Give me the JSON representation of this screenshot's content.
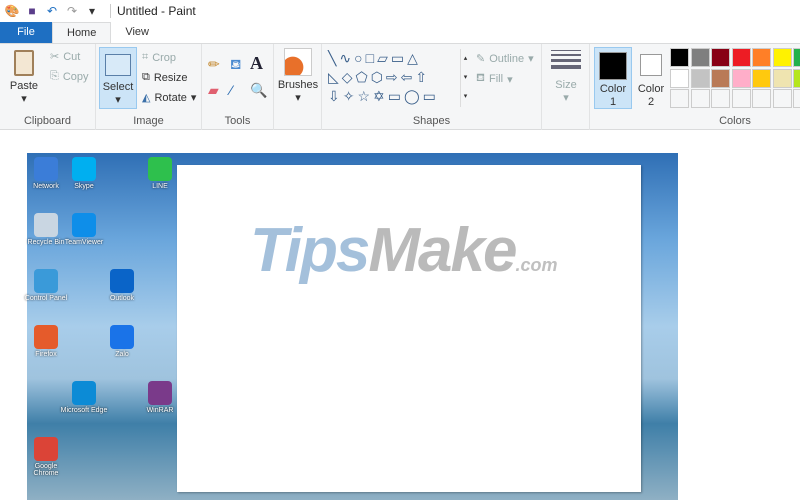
{
  "window": {
    "title": "Untitled - Paint"
  },
  "tabs": [
    {
      "label": "File"
    },
    {
      "label": "Home"
    },
    {
      "label": "View"
    }
  ],
  "clipboard": {
    "paste": "Paste",
    "cut": "Cut",
    "copy": "Copy",
    "label": "Clipboard"
  },
  "image": {
    "select": "Select",
    "crop": "Crop",
    "resize": "Resize",
    "rotate": "Rotate",
    "label": "Image"
  },
  "tools": {
    "label": "Tools"
  },
  "brushes": {
    "label": "Brushes"
  },
  "shapes": {
    "outline": "Outline",
    "fill": "Fill",
    "label": "Shapes"
  },
  "size": {
    "label": "Size"
  },
  "colors": {
    "color1": "Color",
    "color1_num": "1",
    "color2": "Color",
    "color2_num": "2",
    "label": "Colors",
    "color1_value": "#000000",
    "color2_value": "#ffffff",
    "palette": [
      "#000000",
      "#7f7f7f",
      "#880015",
      "#ed1c24",
      "#ff7f27",
      "#fff200",
      "#22b14c",
      "#ffffff",
      "#c3c3c3",
      "#b97a57",
      "#ffaec9",
      "#ffc90e",
      "#efe4b0",
      "#b5e61d"
    ]
  },
  "desktop_icons": [
    {
      "label": "Network",
      "color": "#3b7dd8"
    },
    {
      "label": "Skype",
      "color": "#00aff0"
    },
    {
      "label": "Recycle Bin",
      "color": "#c9d6e2"
    },
    {
      "label": "TeamViewer",
      "color": "#0e8ee9"
    },
    {
      "label": "Control Panel",
      "color": "#3a9ad9"
    },
    {
      "label": "Outlook",
      "color": "#0a64c8"
    },
    {
      "label": "Firefox",
      "color": "#e55b2b"
    },
    {
      "label": "Zalo",
      "color": "#1a73e8"
    },
    {
      "label": "Google Chrome",
      "color": "#db4437"
    },
    {
      "label": "Microsoft Edge",
      "color": "#0c8bd6"
    },
    {
      "label": "LINE",
      "color": "#2ec04d"
    },
    {
      "label": "WinRAR",
      "color": "#7a3a8a"
    }
  ],
  "watermark": {
    "text1": "Tips",
    "text2": "Make",
    "text3": ".com"
  }
}
